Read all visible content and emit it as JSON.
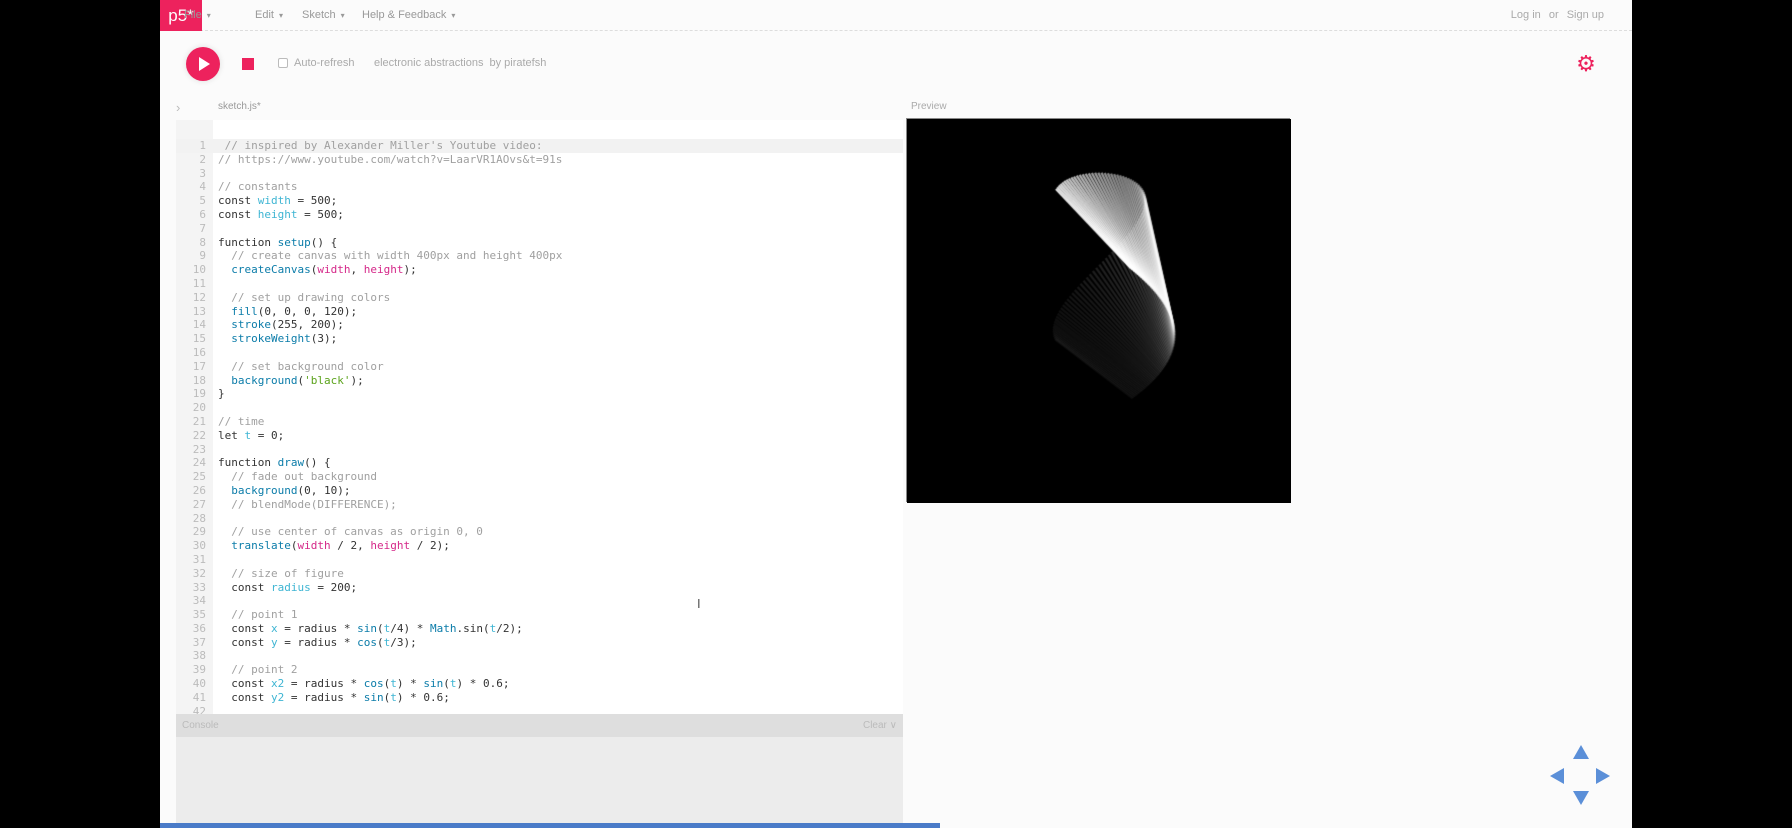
{
  "topbar": {
    "logo": "p5*",
    "menus": [
      "File",
      "Edit",
      "Sketch",
      "Help & Feedback"
    ],
    "login": "Log in",
    "or": "or",
    "signup": "Sign up"
  },
  "toolbar": {
    "auto_refresh": "Auto-refresh",
    "sketch_name": "electronic abstractions",
    "author": "by piratefsh",
    "auto_refresh_checked": false
  },
  "editor": {
    "tab": "sketch.js*",
    "active_line": 1,
    "lines": [
      [
        [
          "c",
          " // inspired by Alexander Miller's Youtube video:"
        ]
      ],
      [
        [
          "c",
          "// https://www.youtube.com/watch?v=LaarVR1AOvs&t=91s"
        ]
      ],
      [],
      [
        [
          "c",
          "// constants"
        ]
      ],
      [
        [
          "k",
          "const "
        ],
        [
          "v",
          "width"
        ],
        [
          "k",
          " = 500;"
        ]
      ],
      [
        [
          "k",
          "const "
        ],
        [
          "v",
          "height"
        ],
        [
          "k",
          " = 500;"
        ]
      ],
      [],
      [
        [
          "k",
          "function "
        ],
        [
          "f",
          "setup"
        ],
        [
          "k",
          "() {"
        ]
      ],
      [
        [
          "c",
          "  // create canvas with width 400px and height 400px"
        ]
      ],
      [
        [
          "f",
          "  createCanvas"
        ],
        [
          "k",
          "("
        ],
        [
          "p",
          "width"
        ],
        [
          "k",
          ", "
        ],
        [
          "p",
          "height"
        ],
        [
          "k",
          ");"
        ]
      ],
      [],
      [
        [
          "c",
          "  // set up drawing colors"
        ]
      ],
      [
        [
          "f",
          "  fill"
        ],
        [
          "k",
          "(0, 0, 0, 120);"
        ]
      ],
      [
        [
          "f",
          "  stroke"
        ],
        [
          "k",
          "(255, 200);"
        ]
      ],
      [
        [
          "f",
          "  strokeWeight"
        ],
        [
          "k",
          "(3);"
        ]
      ],
      [],
      [
        [
          "c",
          "  // set background color"
        ]
      ],
      [
        [
          "f",
          "  background"
        ],
        [
          "k",
          "("
        ],
        [
          "s",
          "'black'"
        ],
        [
          "k",
          ");"
        ]
      ],
      [
        [
          "k",
          "}"
        ]
      ],
      [],
      [
        [
          "c",
          "// time"
        ]
      ],
      [
        [
          "k",
          "let "
        ],
        [
          "v",
          "t"
        ],
        [
          "k",
          " = 0;"
        ]
      ],
      [],
      [
        [
          "k",
          "function "
        ],
        [
          "f",
          "draw"
        ],
        [
          "k",
          "() {"
        ]
      ],
      [
        [
          "c",
          "  // fade out background"
        ]
      ],
      [
        [
          "f",
          "  background"
        ],
        [
          "k",
          "(0, 10);"
        ]
      ],
      [
        [
          "c",
          "  // blendMode(DIFFERENCE);"
        ]
      ],
      [],
      [
        [
          "c",
          "  // use center of canvas as origin 0, 0"
        ]
      ],
      [
        [
          "f",
          "  translate"
        ],
        [
          "k",
          "("
        ],
        [
          "p",
          "width"
        ],
        [
          "k",
          " / 2, "
        ],
        [
          "p",
          "height"
        ],
        [
          "k",
          " / 2);"
        ]
      ],
      [],
      [
        [
          "c",
          "  // size of figure"
        ]
      ],
      [
        [
          "k",
          "  const "
        ],
        [
          "v",
          "radius"
        ],
        [
          "k",
          " = 200;"
        ]
      ],
      [],
      [
        [
          "c",
          "  // point 1"
        ]
      ],
      [
        [
          "k",
          "  const "
        ],
        [
          "v",
          "x"
        ],
        [
          "k",
          " = radius * "
        ],
        [
          "f",
          "sin"
        ],
        [
          "k",
          "("
        ],
        [
          "v",
          "t"
        ],
        [
          "k",
          "/4) * "
        ],
        [
          "f",
          "Math"
        ],
        [
          "k",
          ".sin("
        ],
        [
          "v",
          "t"
        ],
        [
          "k",
          "/2);"
        ]
      ],
      [
        [
          "k",
          "  const "
        ],
        [
          "v",
          "y"
        ],
        [
          "k",
          " = radius * "
        ],
        [
          "f",
          "cos"
        ],
        [
          "k",
          "("
        ],
        [
          "v",
          "t"
        ],
        [
          "k",
          "/3);"
        ]
      ],
      [],
      [
        [
          "c",
          "  // point 2"
        ]
      ],
      [
        [
          "k",
          "  const "
        ],
        [
          "v",
          "x2"
        ],
        [
          "k",
          " = radius * "
        ],
        [
          "f",
          "cos"
        ],
        [
          "k",
          "("
        ],
        [
          "v",
          "t"
        ],
        [
          "k",
          ") * "
        ],
        [
          "f",
          "sin"
        ],
        [
          "k",
          "("
        ],
        [
          "v",
          "t"
        ],
        [
          "k",
          ") * 0.6;"
        ]
      ],
      [
        [
          "k",
          "  const "
        ],
        [
          "v",
          "y2"
        ],
        [
          "k",
          " = radius * "
        ],
        [
          "f",
          "sin"
        ],
        [
          "k",
          "("
        ],
        [
          "v",
          "t"
        ],
        [
          "k",
          ") * 0.6;"
        ]
      ],
      []
    ]
  },
  "preview": {
    "label": "Preview"
  },
  "console": {
    "label": "Console",
    "clear": "Clear"
  },
  "colors": {
    "accent": "#ed225d",
    "nav": "#5b8fd8",
    "progress": "#4a7bc8"
  }
}
